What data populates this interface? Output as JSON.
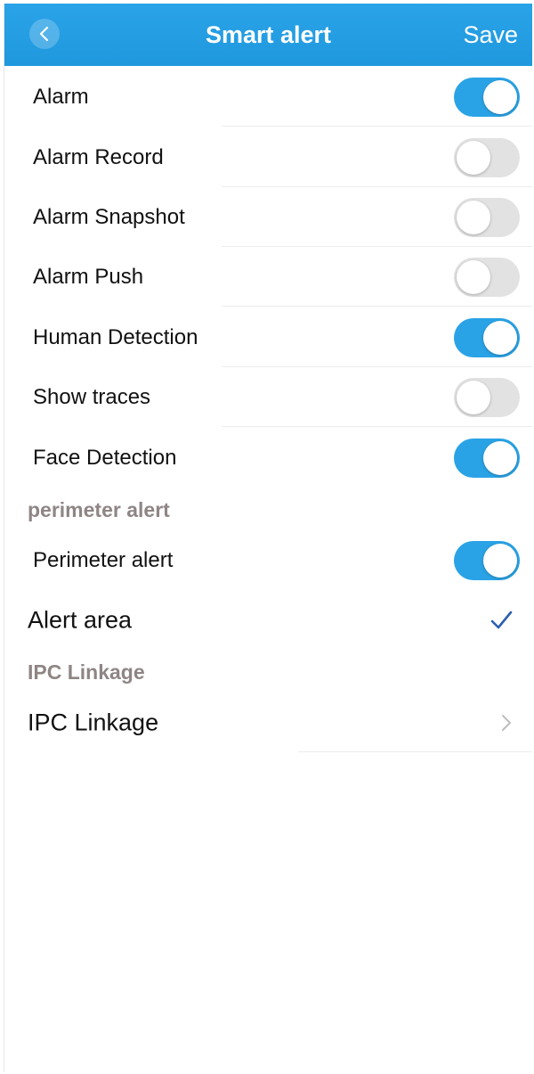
{
  "header": {
    "title": "Smart alert",
    "save_label": "Save",
    "back_icon": "back-chevron-icon"
  },
  "colors": {
    "header_blue": "#2aa3e8",
    "toggle_on": "#2aa3e6",
    "toggle_off": "#e2e2e2",
    "section_text": "#8f8585",
    "check_blue": "#2a5fb0"
  },
  "settings": {
    "alarm": {
      "label": "Alarm",
      "on": true
    },
    "alarm_record": {
      "label": "Alarm Record",
      "on": false
    },
    "alarm_snapshot": {
      "label": "Alarm Snapshot",
      "on": false
    },
    "alarm_push": {
      "label": "Alarm Push",
      "on": false
    },
    "human_detection": {
      "label": "Human Detection",
      "on": true
    },
    "show_traces": {
      "label": "Show traces",
      "on": false
    },
    "face_detection": {
      "label": "Face Detection",
      "on": true
    }
  },
  "perimeter": {
    "section_label": "perimeter alert",
    "perimeter_alert": {
      "label": "Perimeter alert",
      "on": true
    },
    "alert_area": {
      "label": "Alert area",
      "selected": true,
      "icon": "checkmark-icon"
    }
  },
  "ipc": {
    "section_label": "IPC Linkage",
    "item_label": "IPC Linkage",
    "icon": "chevron-right-icon"
  }
}
